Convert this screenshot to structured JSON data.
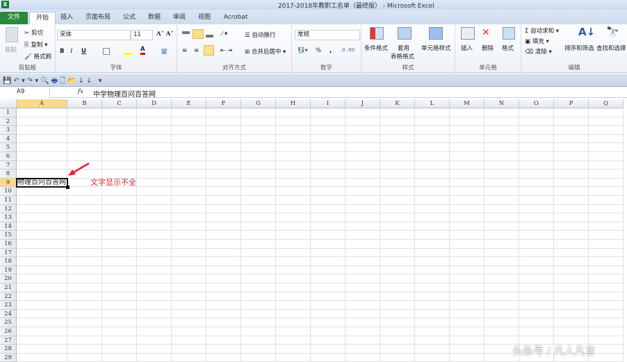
{
  "window": {
    "title": "2017-2018年教职工名单（最终版） - Microsoft Excel",
    "app_icon": "excel-icon"
  },
  "tabs": [
    "文件",
    "开始",
    "插入",
    "页面布局",
    "公式",
    "数据",
    "审阅",
    "视图",
    "Acrobat"
  ],
  "active_tab": "开始",
  "ribbon": {
    "clipboard": {
      "label": "剪贴板",
      "paste": "粘贴",
      "cut": "剪切",
      "copy": "复制",
      "format_painter": "格式刷"
    },
    "font": {
      "label": "字体",
      "font_name": "宋体",
      "font_size": "11",
      "bold": "B",
      "italic": "I",
      "underline": "U",
      "font_color": "#e00000",
      "fill_color": "#ffff00"
    },
    "alignment": {
      "label": "对齐方式",
      "wrap_text": "自动换行",
      "merge_center": "合并后居中"
    },
    "number": {
      "label": "数字",
      "format": "常规",
      "percent": "%",
      "comma": ","
    },
    "styles": {
      "label": "样式",
      "conditional": "条件格式",
      "table_line1": "套用",
      "table_line2": "表格格式",
      "cell_styles": "单元格样式"
    },
    "cells": {
      "label": "单元格",
      "insert": "插入",
      "delete": "删除",
      "format": "格式"
    },
    "editing": {
      "label": "编辑",
      "autosum": "自动求和",
      "fill": "填充",
      "clear": "清除",
      "sort_filter": "排序和筛选",
      "find_select": "查找和选择"
    }
  },
  "formula_bar": {
    "name_box": "A9",
    "fx": "fx",
    "content": "中学物理百问百答网"
  },
  "sheet": {
    "columns": [
      "A",
      "B",
      "C",
      "D",
      "E",
      "F",
      "G",
      "H",
      "I",
      "J",
      "K",
      "L",
      "M",
      "N",
      "O",
      "P",
      "Q"
    ],
    "rows": [
      1,
      2,
      3,
      4,
      5,
      6,
      7,
      8,
      9,
      10,
      11,
      12,
      13,
      14,
      15,
      16,
      17,
      18,
      19,
      20,
      21,
      22,
      23,
      24,
      25,
      26,
      27,
      28,
      29
    ],
    "active_cell": "A9",
    "a9_visible": "物理百问百答网"
  },
  "annotation": {
    "text": "文字显示不全",
    "color": "#e8202a"
  },
  "watermark": "头条号 / 凡人凡言"
}
